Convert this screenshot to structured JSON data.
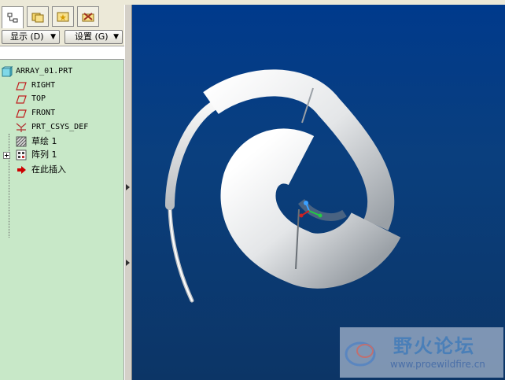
{
  "panel": {
    "display_menu": "显示 (D)",
    "settings_menu": "设置 (G)"
  },
  "tree": {
    "root": "ARRAY_01.PRT",
    "items": [
      {
        "label": "RIGHT",
        "icon": "datum-plane-icon"
      },
      {
        "label": "TOP",
        "icon": "datum-plane-icon"
      },
      {
        "label": "FRONT",
        "icon": "datum-plane-icon"
      },
      {
        "label": "PRT_CSYS_DEF",
        "icon": "coordinate-system-icon"
      },
      {
        "label": "草绘 1",
        "icon": "sketch-icon"
      },
      {
        "label": "阵列 1",
        "icon": "pattern-icon"
      },
      {
        "label": "在此插入",
        "icon": "insert-here-arrow-icon"
      }
    ]
  },
  "watermark": {
    "title": "野火论坛",
    "url": "www.proewildfire.cn"
  },
  "colors": {
    "tree_bg": "#c8e8c8",
    "viewport_bg": "#0c3a78",
    "insert_arrow": "#cc0000"
  }
}
